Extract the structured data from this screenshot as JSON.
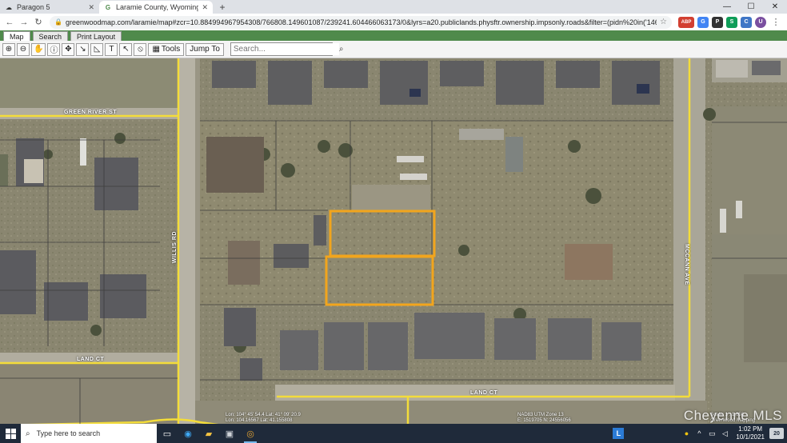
{
  "browser": {
    "tabs": [
      {
        "label": "Paragon 5",
        "icon": "cloud-icon",
        "active": false
      },
      {
        "label": "Laramie County, Wyoming, Map",
        "icon": "greenwood-g-icon",
        "active": true
      }
    ],
    "new_tab": "+",
    "window_controls": {
      "minimize": "—",
      "maximize": "☐",
      "close": "✕"
    },
    "url": "greenwoodmap.com/laramie/map#zcr=10.884994967954308/766808.149601087/239241.604466063173/0&lyrs=a20.publiclands.physftr.ownership.impsonly.roads&filter=(pidn%20in('14662722003800'%2C'14662722003900')",
    "extensions": [
      {
        "label": "ABP",
        "color": "#d23f31"
      },
      {
        "label": "G",
        "color": "#4285f4"
      },
      {
        "label": "P",
        "color": "#333333"
      },
      {
        "label": "S",
        "color": "#0f9d58"
      },
      {
        "label": "C",
        "color": "#3f76c6"
      },
      {
        "label": "U",
        "color": "#7a4fa0"
      }
    ]
  },
  "app": {
    "tabs": [
      "Map",
      "Search",
      "Print Layout"
    ],
    "active_tab": "Map"
  },
  "toolbar": {
    "tools": [
      {
        "name": "zoom-in-tool",
        "glyph": "⊕"
      },
      {
        "name": "zoom-out-tool",
        "glyph": "⊖"
      },
      {
        "name": "pan-tool",
        "glyph": "✋"
      },
      {
        "name": "identify-tool",
        "glyph": "ⓘ"
      },
      {
        "name": "full-extent-tool",
        "glyph": "✥"
      },
      {
        "name": "measure-tool",
        "glyph": "↘"
      },
      {
        "name": "area-tool",
        "glyph": "◺"
      },
      {
        "name": "text-tool",
        "glyph": "T"
      },
      {
        "name": "select-tool",
        "glyph": "↖"
      },
      {
        "name": "clear-tool",
        "glyph": "⦸"
      }
    ],
    "tools_label": "Tools",
    "jump_to_label": "Jump To",
    "search_placeholder": "Search..."
  },
  "map": {
    "streets": {
      "green_river": "GREEN RIVER ST",
      "willis": "WILLIS RD",
      "land_ct_west": "LAND CT",
      "land_ct_east": "LAND CT",
      "mccann": "MCCANN AVE"
    },
    "readout_left": [
      "Lon: 104° 45' 54.4  Lat: 41° 09' 20.9",
      "Lon: 104.16567  Lat: 41.155808"
    ],
    "readout_center": [
      "NAD83 UTM Zone 13",
      "E: 1519705  N: 24556056"
    ],
    "scale": [
      "Scale: 1 : 1,656",
      "Greenwood Mapping"
    ],
    "watermark": "Cheyenne MLS",
    "highlight_color": "#f2a51d"
  },
  "taskbar": {
    "search_placeholder": "Type here to search",
    "time": "1:02 PM",
    "date": "10/1/2021",
    "notification_count": "20"
  }
}
